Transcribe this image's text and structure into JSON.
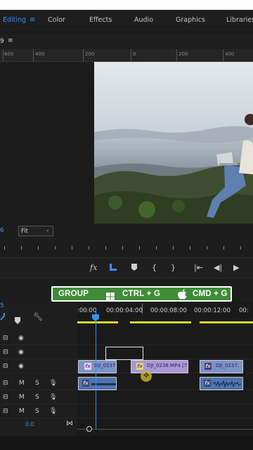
{
  "workspace": {
    "tabs": [
      "Editing",
      "Color",
      "Effects",
      "Audio",
      "Graphics",
      "Libraries"
    ],
    "active": "Editing",
    "menu_icon": "hamburger-icon"
  },
  "monitor": {
    "number": "9",
    "menu_icon": "hamburger-icon",
    "ruler_labels": [
      "600",
      "400",
      "200",
      "0",
      "200",
      "400"
    ],
    "timecode_fragment": "6",
    "fit": "Fit"
  },
  "transport": {
    "buttons": [
      "fx-icon",
      "marker-icon",
      "add-marker-icon",
      "mark-in-icon",
      "mark-out-icon",
      "go-to-in-icon",
      "step-back-icon",
      "play-icon"
    ]
  },
  "banner": {
    "group": "GROUP",
    "windows_shortcut": "CTRL + G",
    "mac_shortcut": "CMD + G",
    "windows_icon": "windows-logo-icon",
    "mac_icon": "apple-logo-icon"
  },
  "timeline": {
    "timecode_fragment": "5",
    "ruler": [
      ":00:00",
      "00:00:04:00",
      "00:00:08:00",
      "00:00:12:00",
      "00:"
    ],
    "track_toggle": "M",
    "track_solo": "S",
    "bottom_value": "0.0",
    "clips": {
      "v1_a": "Dji_0237",
      "v1_b": "DJI_0238.MP4 [7",
      "v1_c": "DJI_0237."
    }
  },
  "colors": {
    "accent": "#3f8fef",
    "banner": "#3e8c36",
    "video_clip": "#a79ad6",
    "video_clip_alt": "#7c93c7",
    "audio_clip": "#4e74b0",
    "work_area": "#d8d82b"
  }
}
